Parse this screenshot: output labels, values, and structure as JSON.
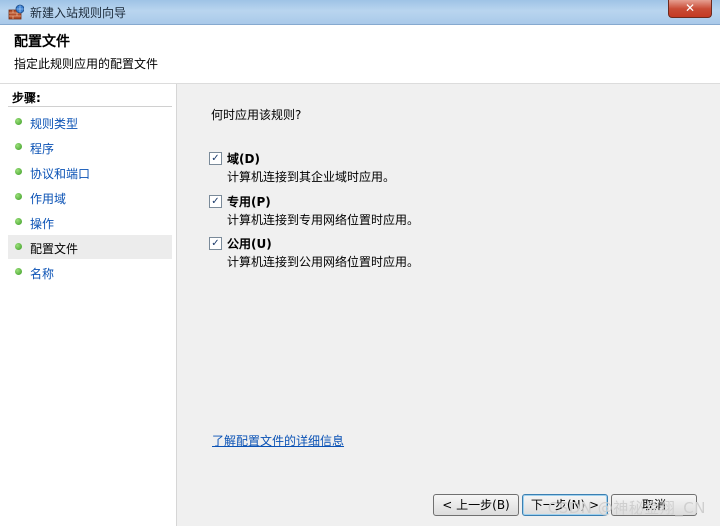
{
  "window": {
    "title": "新建入站规则向导",
    "close_label": "✕"
  },
  "header": {
    "title": "配置文件",
    "subtitle": "指定此规则应用的配置文件"
  },
  "steps": {
    "title": "步骤:",
    "items": [
      {
        "label": "规则类型"
      },
      {
        "label": "程序"
      },
      {
        "label": "协议和端口"
      },
      {
        "label": "作用域"
      },
      {
        "label": "操作"
      },
      {
        "label": "配置文件"
      },
      {
        "label": "名称"
      }
    ]
  },
  "main": {
    "question": "何时应用该规则?",
    "options": [
      {
        "label": "域(D)",
        "desc": "计算机连接到其企业域时应用。",
        "checked": true
      },
      {
        "label": "专用(P)",
        "desc": "计算机连接到专用网络位置时应用。",
        "checked": true
      },
      {
        "label": "公用(U)",
        "desc": "计算机连接到公用网络位置时应用。",
        "checked": true
      }
    ],
    "link": "了解配置文件的详细信息"
  },
  "buttons": {
    "back": "< 上一步(B)",
    "next": "下一步(N) >",
    "cancel": "取消"
  },
  "watermark": "CSDN @神秘金翔_CN",
  "colors": {
    "link": "#0a52b5",
    "titlebar": "#b9d5ef",
    "step_dot": "#3a9b23"
  }
}
